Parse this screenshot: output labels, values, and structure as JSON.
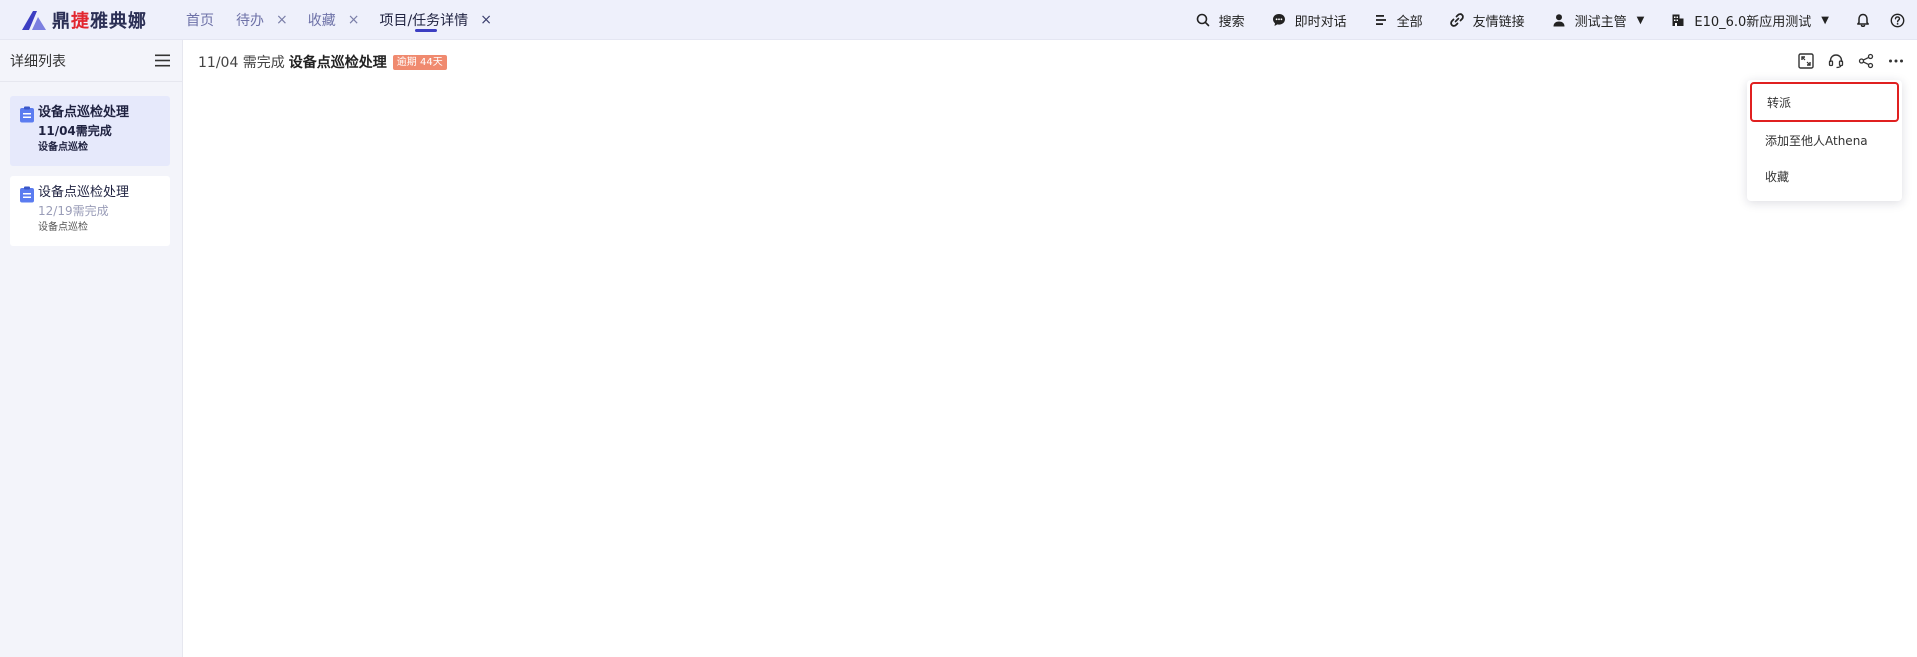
{
  "app": {
    "logo_prefix": "鼎",
    "logo_red": "捷",
    "logo_suffix": "雅典娜",
    "brand_color": "#3c3ec2"
  },
  "tabs": [
    {
      "label": "首页",
      "closable": false
    },
    {
      "label": "待办",
      "closable": true
    },
    {
      "label": "收藏",
      "closable": true
    },
    {
      "label": "项目/任务详情",
      "closable": true,
      "active": true
    }
  ],
  "tab_close_glyph": "×",
  "topbar": {
    "search": "搜索",
    "chat": "即时对话",
    "all": "全部",
    "links": "友情链接",
    "user": "测试主管",
    "tenant": "E10_6.0新应用测试"
  },
  "sidebar": {
    "title": "详细列表",
    "items": [
      {
        "title": "设备点巡检处理",
        "date": "11/04需完成",
        "sub": "设备点巡检",
        "selected": true
      },
      {
        "title": "设备点巡检处理",
        "date": "12/19需完成",
        "sub": "设备点巡检",
        "selected": false
      }
    ]
  },
  "main": {
    "date_prefix": "11/04 需完成",
    "title": "设备点巡检处理",
    "badge": "逾期 44天",
    "badge_color": "#f08a6f"
  },
  "menu": {
    "items": [
      {
        "label": "转派",
        "highlighted": true
      },
      {
        "label": "添加至他人Athena",
        "highlighted": false
      },
      {
        "label": "收藏",
        "highlighted": false
      }
    ],
    "highlight_color": "#e02020"
  }
}
